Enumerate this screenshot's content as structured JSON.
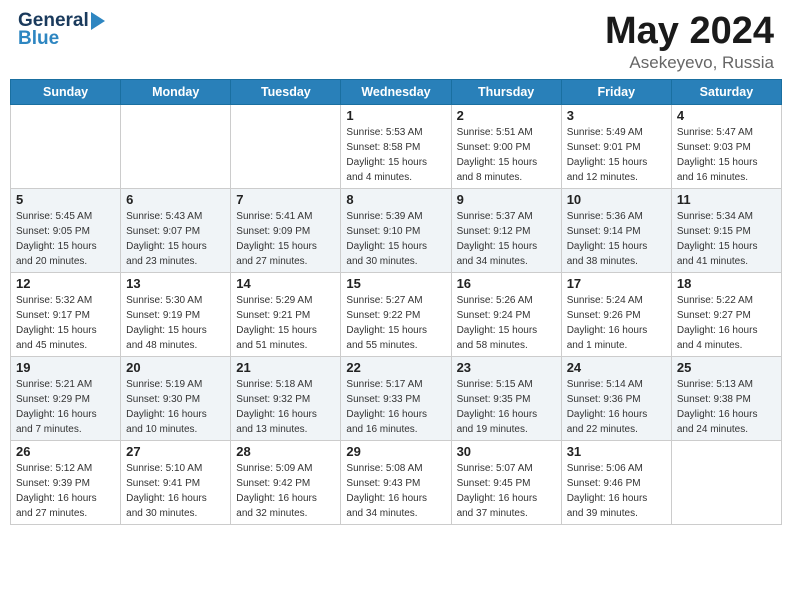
{
  "header": {
    "logo": {
      "line1": "General",
      "line2": "Blue"
    },
    "title": "May 2024",
    "subtitle": "Asekeyevo, Russia"
  },
  "days_of_week": [
    "Sunday",
    "Monday",
    "Tuesday",
    "Wednesday",
    "Thursday",
    "Friday",
    "Saturday"
  ],
  "weeks": [
    {
      "days": [
        {
          "num": "",
          "info": ""
        },
        {
          "num": "",
          "info": ""
        },
        {
          "num": "",
          "info": ""
        },
        {
          "num": "1",
          "info": "Sunrise: 5:53 AM\nSunset: 8:58 PM\nDaylight: 15 hours\nand 4 minutes."
        },
        {
          "num": "2",
          "info": "Sunrise: 5:51 AM\nSunset: 9:00 PM\nDaylight: 15 hours\nand 8 minutes."
        },
        {
          "num": "3",
          "info": "Sunrise: 5:49 AM\nSunset: 9:01 PM\nDaylight: 15 hours\nand 12 minutes."
        },
        {
          "num": "4",
          "info": "Sunrise: 5:47 AM\nSunset: 9:03 PM\nDaylight: 15 hours\nand 16 minutes."
        }
      ]
    },
    {
      "days": [
        {
          "num": "5",
          "info": "Sunrise: 5:45 AM\nSunset: 9:05 PM\nDaylight: 15 hours\nand 20 minutes."
        },
        {
          "num": "6",
          "info": "Sunrise: 5:43 AM\nSunset: 9:07 PM\nDaylight: 15 hours\nand 23 minutes."
        },
        {
          "num": "7",
          "info": "Sunrise: 5:41 AM\nSunset: 9:09 PM\nDaylight: 15 hours\nand 27 minutes."
        },
        {
          "num": "8",
          "info": "Sunrise: 5:39 AM\nSunset: 9:10 PM\nDaylight: 15 hours\nand 30 minutes."
        },
        {
          "num": "9",
          "info": "Sunrise: 5:37 AM\nSunset: 9:12 PM\nDaylight: 15 hours\nand 34 minutes."
        },
        {
          "num": "10",
          "info": "Sunrise: 5:36 AM\nSunset: 9:14 PM\nDaylight: 15 hours\nand 38 minutes."
        },
        {
          "num": "11",
          "info": "Sunrise: 5:34 AM\nSunset: 9:15 PM\nDaylight: 15 hours\nand 41 minutes."
        }
      ]
    },
    {
      "days": [
        {
          "num": "12",
          "info": "Sunrise: 5:32 AM\nSunset: 9:17 PM\nDaylight: 15 hours\nand 45 minutes."
        },
        {
          "num": "13",
          "info": "Sunrise: 5:30 AM\nSunset: 9:19 PM\nDaylight: 15 hours\nand 48 minutes."
        },
        {
          "num": "14",
          "info": "Sunrise: 5:29 AM\nSunset: 9:21 PM\nDaylight: 15 hours\nand 51 minutes."
        },
        {
          "num": "15",
          "info": "Sunrise: 5:27 AM\nSunset: 9:22 PM\nDaylight: 15 hours\nand 55 minutes."
        },
        {
          "num": "16",
          "info": "Sunrise: 5:26 AM\nSunset: 9:24 PM\nDaylight: 15 hours\nand 58 minutes."
        },
        {
          "num": "17",
          "info": "Sunrise: 5:24 AM\nSunset: 9:26 PM\nDaylight: 16 hours\nand 1 minute."
        },
        {
          "num": "18",
          "info": "Sunrise: 5:22 AM\nSunset: 9:27 PM\nDaylight: 16 hours\nand 4 minutes."
        }
      ]
    },
    {
      "days": [
        {
          "num": "19",
          "info": "Sunrise: 5:21 AM\nSunset: 9:29 PM\nDaylight: 16 hours\nand 7 minutes."
        },
        {
          "num": "20",
          "info": "Sunrise: 5:19 AM\nSunset: 9:30 PM\nDaylight: 16 hours\nand 10 minutes."
        },
        {
          "num": "21",
          "info": "Sunrise: 5:18 AM\nSunset: 9:32 PM\nDaylight: 16 hours\nand 13 minutes."
        },
        {
          "num": "22",
          "info": "Sunrise: 5:17 AM\nSunset: 9:33 PM\nDaylight: 16 hours\nand 16 minutes."
        },
        {
          "num": "23",
          "info": "Sunrise: 5:15 AM\nSunset: 9:35 PM\nDaylight: 16 hours\nand 19 minutes."
        },
        {
          "num": "24",
          "info": "Sunrise: 5:14 AM\nSunset: 9:36 PM\nDaylight: 16 hours\nand 22 minutes."
        },
        {
          "num": "25",
          "info": "Sunrise: 5:13 AM\nSunset: 9:38 PM\nDaylight: 16 hours\nand 24 minutes."
        }
      ]
    },
    {
      "days": [
        {
          "num": "26",
          "info": "Sunrise: 5:12 AM\nSunset: 9:39 PM\nDaylight: 16 hours\nand 27 minutes."
        },
        {
          "num": "27",
          "info": "Sunrise: 5:10 AM\nSunset: 9:41 PM\nDaylight: 16 hours\nand 30 minutes."
        },
        {
          "num": "28",
          "info": "Sunrise: 5:09 AM\nSunset: 9:42 PM\nDaylight: 16 hours\nand 32 minutes."
        },
        {
          "num": "29",
          "info": "Sunrise: 5:08 AM\nSunset: 9:43 PM\nDaylight: 16 hours\nand 34 minutes."
        },
        {
          "num": "30",
          "info": "Sunrise: 5:07 AM\nSunset: 9:45 PM\nDaylight: 16 hours\nand 37 minutes."
        },
        {
          "num": "31",
          "info": "Sunrise: 5:06 AM\nSunset: 9:46 PM\nDaylight: 16 hours\nand 39 minutes."
        },
        {
          "num": "",
          "info": ""
        }
      ]
    }
  ]
}
